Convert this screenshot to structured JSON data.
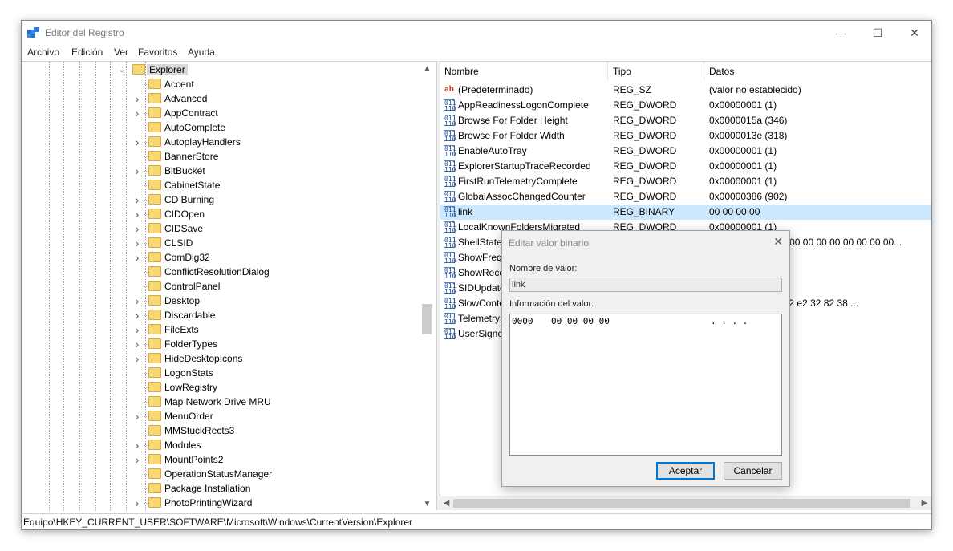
{
  "window": {
    "title": "Editor del Registro"
  },
  "menu": [
    "Archivo",
    "Edición",
    "Ver",
    "Favoritos",
    "Ayuda"
  ],
  "tree": {
    "parent": "Explorer",
    "children": [
      "Accent",
      "Advanced",
      "AppContract",
      "AutoComplete",
      "AutoplayHandlers",
      "BannerStore",
      "BitBucket",
      "CabinetState",
      "CD Burning",
      "CIDOpen",
      "CIDSave",
      "CLSID",
      "ComDlg32",
      "ConflictResolutionDialog",
      "ControlPanel",
      "Desktop",
      "Discardable",
      "FileExts",
      "FolderTypes",
      "HideDesktopIcons",
      "LogonStats",
      "LowRegistry",
      "Map Network Drive MRU",
      "MenuOrder",
      "MMStuckRects3",
      "Modules",
      "MountPoints2",
      "OperationStatusManager",
      "Package Installation",
      "PhotoPrintingWizard"
    ],
    "expandable": [
      false,
      true,
      true,
      false,
      true,
      false,
      true,
      false,
      true,
      true,
      true,
      true,
      true,
      false,
      false,
      true,
      true,
      true,
      true,
      true,
      false,
      false,
      false,
      true,
      false,
      true,
      true,
      false,
      false,
      true
    ]
  },
  "list": {
    "columns": [
      "Nombre",
      "Tipo",
      "Datos"
    ],
    "rows": [
      {
        "name": "(Predeterminado)",
        "type": "REG_SZ",
        "data": "(valor no establecido)",
        "icon": "string-value-icon"
      },
      {
        "name": "AppReadinessLogonComplete",
        "type": "REG_DWORD",
        "data": "0x00000001 (1)",
        "icon": "binary-value-icon"
      },
      {
        "name": "Browse For Folder Height",
        "type": "REG_DWORD",
        "data": "0x0000015a (346)",
        "icon": "binary-value-icon"
      },
      {
        "name": "Browse For Folder Width",
        "type": "REG_DWORD",
        "data": "0x0000013e (318)",
        "icon": "binary-value-icon"
      },
      {
        "name": "EnableAutoTray",
        "type": "REG_DWORD",
        "data": "0x00000001 (1)",
        "icon": "binary-value-icon"
      },
      {
        "name": "ExplorerStartupTraceRecorded",
        "type": "REG_DWORD",
        "data": "0x00000001 (1)",
        "icon": "binary-value-icon"
      },
      {
        "name": "FirstRunTelemetryComplete",
        "type": "REG_DWORD",
        "data": "0x00000001 (1)",
        "icon": "binary-value-icon"
      },
      {
        "name": "GlobalAssocChangedCounter",
        "type": "REG_DWORD",
        "data": "0x00000386 (902)",
        "icon": "binary-value-icon"
      },
      {
        "name": "link",
        "type": "REG_BINARY",
        "data": "00 00 00 00",
        "icon": "binary-value-icon"
      },
      {
        "name": "LocalKnownFoldersMigrated",
        "type": "REG_DWORD",
        "data": "0x00000001 (1)",
        "icon": "binary-value-icon"
      },
      {
        "name": "ShellState",
        "type": "",
        "data": "00 00 00 00 00 00 00 00 00 00 00 00 00 00...",
        "icon": "binary-value-icon"
      },
      {
        "name": "ShowFrequ",
        "type": "",
        "data": "",
        "icon": "binary-value-icon"
      },
      {
        "name": "ShowRecen",
        "type": "",
        "data": "",
        "icon": "binary-value-icon"
      },
      {
        "name": "SIDUpdate",
        "type": "",
        "data": "",
        "icon": "binary-value-icon"
      },
      {
        "name": "SlowConte",
        "type": "",
        "data": "3 4d 9c ed e9 1e 22 e2 32 82 38 ...",
        "icon": "binary-value-icon"
      },
      {
        "name": "TelemetryS",
        "type": "",
        "data": "",
        "icon": "binary-value-icon"
      },
      {
        "name": "UserSigned",
        "type": "",
        "data": "",
        "icon": "binary-value-icon"
      }
    ],
    "selected_index": 8
  },
  "status": {
    "path": "Equipo\\HKEY_CURRENT_USER\\SOFTWARE\\Microsoft\\Windows\\CurrentVersion\\Explorer"
  },
  "dialog": {
    "title": "Editar valor binario",
    "name_label": "Nombre de valor:",
    "name_value": "link",
    "data_label": "Información del valor:",
    "addr": "0000",
    "bytes": "00 00 00 00",
    "ascii": ". . . .",
    "ok": "Aceptar",
    "cancel": "Cancelar"
  },
  "colors": {
    "selection": "#cce8ff",
    "tree_selection": "#d9d9d9",
    "folder": "#f8d775",
    "accent": "#0078d7"
  }
}
